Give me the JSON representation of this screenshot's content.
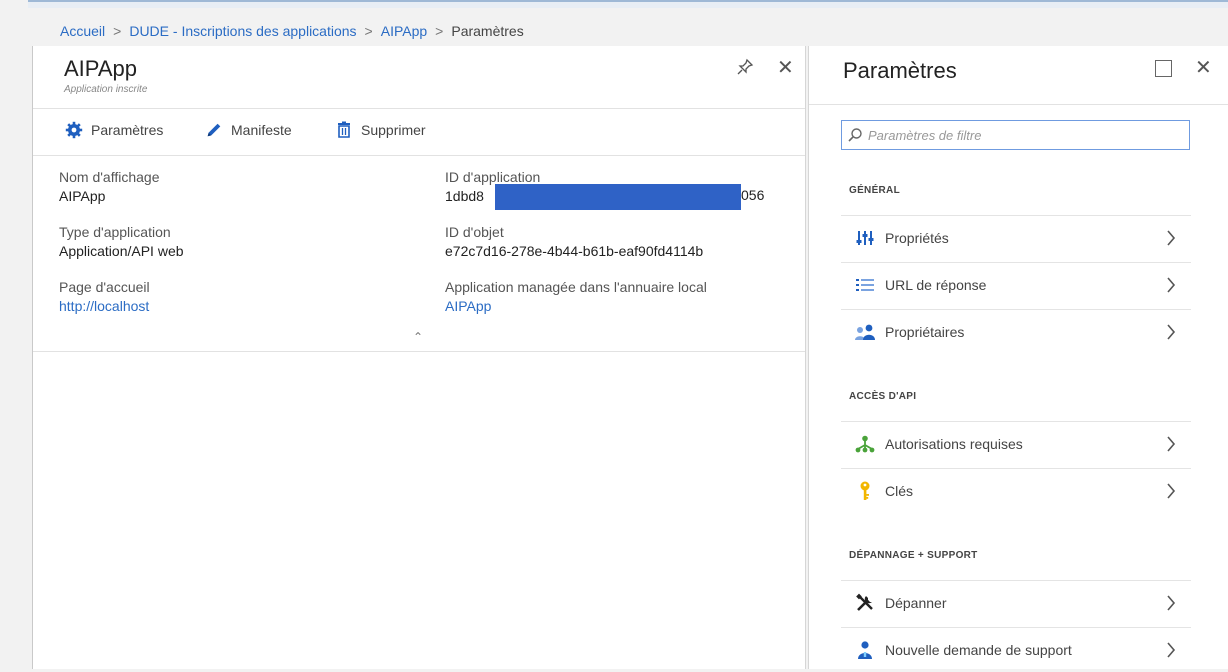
{
  "breadcrumb": {
    "items": [
      "Accueil",
      "DUDE - Inscriptions des applications",
      "AIPApp",
      "Paramètres"
    ],
    "separator": ">"
  },
  "app_blade": {
    "title": "AIPApp",
    "subtitle": "Application inscrite",
    "toolbar": {
      "settings_label": "Paramètres",
      "manifest_label": "Manifeste",
      "delete_label": "Supprimer"
    },
    "essentials": {
      "display_name_label": "Nom d'affichage",
      "display_name_value": "AIPApp",
      "app_type_label": "Type d'application",
      "app_type_value": "Application/API web",
      "home_page_label": "Page d'accueil",
      "home_page_value": "http://localhost",
      "app_id_label": "ID d'application",
      "app_id_visible_prefix": "1dbd8",
      "app_id_visible_suffix": "056",
      "object_id_label": "ID d'objet",
      "object_id_value": "e72c7d16-278e-4b44-b61b-eaf90fd4114b",
      "managed_app_label": "Application managée dans l'annuaire local",
      "managed_app_value": "AIPApp"
    },
    "collapse_glyph": "⌃"
  },
  "settings_blade": {
    "title": "Paramètres",
    "search_placeholder": "Paramètres de filtre",
    "sections": [
      {
        "heading": "GÉNÉRAL",
        "items": [
          {
            "label": "Propriétés",
            "icon": "properties-icon"
          },
          {
            "label": "URL de réponse",
            "icon": "reply-urls-icon"
          },
          {
            "label": "Propriétaires",
            "icon": "owners-icon"
          }
        ]
      },
      {
        "heading": "ACCÈS D'API",
        "items": [
          {
            "label": "Autorisations requises",
            "icon": "permissions-icon"
          },
          {
            "label": "Clés",
            "icon": "key-icon"
          }
        ]
      },
      {
        "heading": "DÉPANNAGE + SUPPORT",
        "items": [
          {
            "label": "Dépanner",
            "icon": "troubleshoot-icon"
          },
          {
            "label": "Nouvelle demande de support",
            "icon": "support-request-icon"
          }
        ]
      }
    ]
  },
  "colors": {
    "link": "#2b6cc4",
    "redaction": "#2f62c6",
    "search_border": "#6f9be0"
  }
}
